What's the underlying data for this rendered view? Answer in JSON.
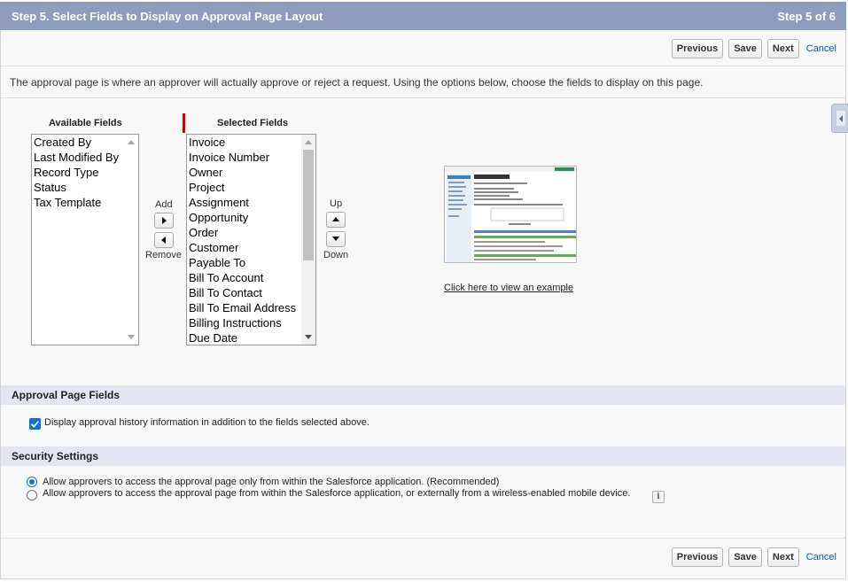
{
  "header": {
    "title": "Step 5. Select Fields to Display on Approval Page Layout",
    "step": "Step 5 of 6"
  },
  "buttons": {
    "previous": "Previous",
    "save": "Save",
    "next": "Next",
    "cancel": "Cancel"
  },
  "description": "The approval page is where an approver will actually approve or reject a request. Using the options below, choose the fields to display on this page.",
  "available": {
    "title": "Available Fields",
    "items": [
      "Created By",
      "Last Modified By",
      "Record Type",
      "Status",
      "Tax Template"
    ]
  },
  "selected": {
    "title": "Selected Fields",
    "items": [
      "Invoice",
      "Invoice Number",
      "Owner",
      "Project",
      "Assignment",
      "Opportunity",
      "Order",
      "Customer",
      "Payable To",
      "Bill To Account",
      "Bill To Contact",
      "Bill To Email Address",
      "Billing Instructions",
      "Due Date"
    ]
  },
  "controls": {
    "add": "Add",
    "remove": "Remove",
    "up": "Up",
    "down": "Down"
  },
  "preview": {
    "link": "Click here to view an example"
  },
  "approval_section": {
    "title": "Approval Page Fields",
    "checkbox_label": "Display approval history information in addition to the fields selected above.",
    "checked": true
  },
  "security_section": {
    "title": "Security Settings",
    "option1": "Allow approvers to access the approval page only from within the Salesforce application. (Recommended)",
    "option2": "Allow approvers to access the approval page from within the Salesforce application, or externally from a wireless-enabled mobile device.",
    "info_glyph": "i"
  },
  "icons": [
    "triangle-right-icon",
    "triangle-left-icon",
    "triangle-up-icon",
    "triangle-down-icon",
    "info-icon",
    "checkmark-icon",
    "sidebar-collapse-icon"
  ],
  "colors": {
    "header_bg": "#8e9dbe",
    "section_bg": "#e3e6f0",
    "accent": "#0b72d9",
    "link": "#015ba7",
    "required_bar": "#cc0000"
  }
}
